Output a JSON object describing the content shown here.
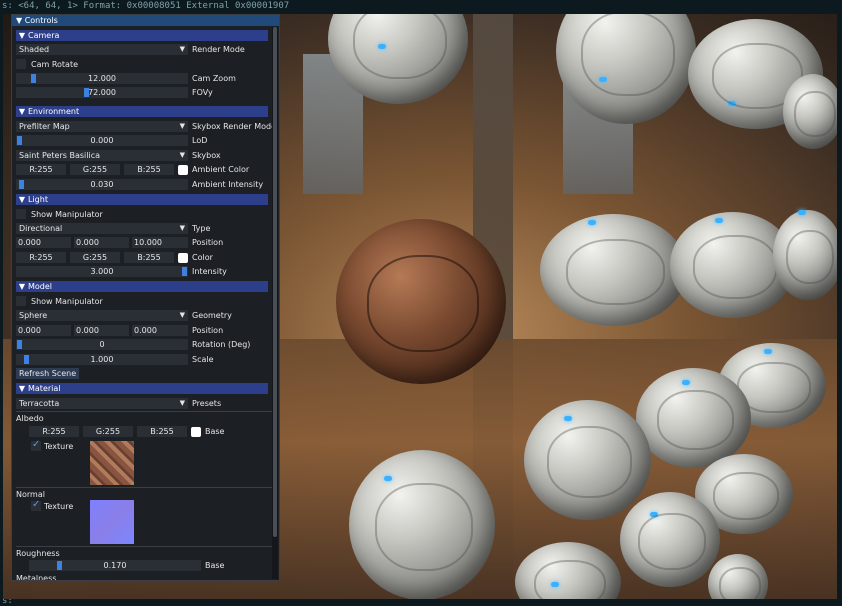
{
  "console": {
    "top_line": "s: <64, 64, 1> Format: 0x00008051 External 0x00001907",
    "bottom_line": "s:"
  },
  "panel": {
    "title": "Controls",
    "camera": {
      "header": "Camera",
      "render_mode_value": "Shaded",
      "render_mode_label": "Render Mode",
      "cam_rotate_label": "Cam Rotate",
      "cam_zoom_value": "12.000",
      "cam_zoom_label": "Cam Zoom",
      "fovy_value": "72.000",
      "fovy_label": "FOVy"
    },
    "environment": {
      "header": "Environment",
      "skybox_render_mode_value": "Prefilter Map",
      "skybox_render_mode_label": "Skybox Render Mode",
      "lod_value": "0.000",
      "lod_label": "LoD",
      "skybox_value": "Saint Peters Basilica",
      "skybox_label": "Skybox",
      "ambient_r": "R:255",
      "ambient_g": "G:255",
      "ambient_b": "B:255",
      "ambient_color_label": "Ambient Color",
      "ambient_intensity_value": "0.030",
      "ambient_intensity_label": "Ambient Intensity"
    },
    "light": {
      "header": "Light",
      "show_manipulator_label": "Show Manipulator",
      "type_value": "Directional",
      "type_label": "Type",
      "pos_x": "0.000",
      "pos_y": "0.000",
      "pos_z": "10.000",
      "position_label": "Position",
      "color_r": "R:255",
      "color_g": "G:255",
      "color_b": "B:255",
      "color_label": "Color",
      "intensity_value": "3.000",
      "intensity_label": "Intensity"
    },
    "model": {
      "header": "Model",
      "show_manipulator_label": "Show Manipulator",
      "geometry_value": "Sphere",
      "geometry_label": "Geometry",
      "pos_x": "0.000",
      "pos_y": "0.000",
      "pos_z": "0.000",
      "position_label": "Position",
      "rotation_value": "0",
      "rotation_label": "Rotation (Deg)",
      "scale_value": "1.000",
      "scale_label": "Scale",
      "refresh_label": "Refresh Scene"
    },
    "material": {
      "header": "Material",
      "presets_value": "Terracotta",
      "presets_label": "Presets",
      "albedo_title": "Albedo",
      "albedo_r": "R:255",
      "albedo_g": "G:255",
      "albedo_b": "B:255",
      "albedo_base_label": "Base",
      "albedo_texture_label": "Texture",
      "normal_title": "Normal",
      "normal_texture_label": "Texture",
      "roughness_title": "Roughness",
      "roughness_value": "0.170",
      "roughness_base_label": "Base",
      "metalness_title": "Metalness"
    }
  },
  "colors": {
    "header_bg": "#2d3f8a",
    "title_bg": "#1f4a7a",
    "accent": "#3d82e0"
  }
}
